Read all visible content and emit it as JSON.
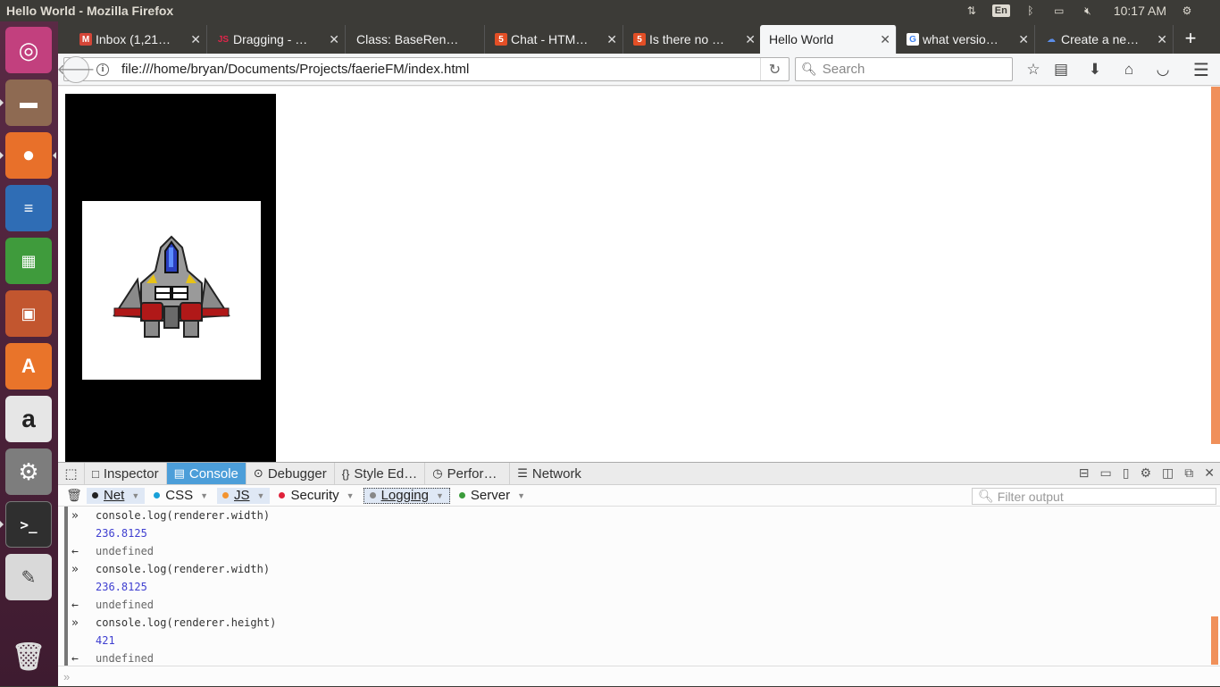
{
  "topbar": {
    "title": "Hello World - Mozilla Firefox",
    "language": "En",
    "time": "10:17 AM"
  },
  "tabs": [
    {
      "label": "Inbox (1,21…",
      "favicon": "gmail-icon",
      "color": "#d44638",
      "glyph": "M"
    },
    {
      "label": "Dragging - …",
      "favicon": "js-icon",
      "color": "#e0254a",
      "glyph": "JS"
    },
    {
      "label": "Class: BaseRen…",
      "favicon": "",
      "color": "",
      "glyph": ""
    },
    {
      "label": "Chat - HTM…",
      "favicon": "html5-icon",
      "color": "#e34f26",
      "glyph": "5"
    },
    {
      "label": "Is there no …",
      "favicon": "html5-icon",
      "color": "#e34f26",
      "glyph": "5"
    },
    {
      "label": "Hello World",
      "favicon": "",
      "color": "",
      "glyph": ""
    },
    {
      "label": "what versio…",
      "favicon": "google-icon",
      "color": "#4285f4",
      "glyph": "G"
    },
    {
      "label": "Create a ne…",
      "favicon": "cloud-icon",
      "color": "#3b6fd8",
      "glyph": "☁"
    }
  ],
  "navbar": {
    "url": "file:///home/bryan/Documents/Projects/faerieFM/index.html",
    "search_placeholder": "Search"
  },
  "devtools": {
    "tabs": [
      {
        "label": "Inspector",
        "icon": "□"
      },
      {
        "label": "Console",
        "icon": "▤"
      },
      {
        "label": "Debugger",
        "icon": "⊙"
      },
      {
        "label": "Style Ed…",
        "icon": "{}"
      },
      {
        "label": "Perfor…",
        "icon": "◷"
      },
      {
        "label": "Network",
        "icon": "☰"
      }
    ],
    "filters": [
      {
        "label": "Net",
        "color": "#222222"
      },
      {
        "label": "CSS",
        "color": "#18a0d8"
      },
      {
        "label": "JS",
        "color": "#f39430"
      },
      {
        "label": "Security",
        "color": "#e0223a"
      },
      {
        "label": "Logging",
        "color": "#888888"
      },
      {
        "label": "Server",
        "color": "#3b9c3b"
      }
    ],
    "filter_placeholder": "Filter output",
    "log": [
      {
        "kind": "input",
        "text": "console.log(renderer.width)"
      },
      {
        "kind": "number",
        "text": "236.8125"
      },
      {
        "kind": "return",
        "text": "undefined"
      },
      {
        "kind": "input",
        "text": "console.log(renderer.width)"
      },
      {
        "kind": "number",
        "text": "236.8125"
      },
      {
        "kind": "return",
        "text": "undefined"
      },
      {
        "kind": "input",
        "text": "console.log(renderer.height)"
      },
      {
        "kind": "number",
        "text": "421"
      },
      {
        "kind": "return",
        "text": "undefined"
      }
    ]
  },
  "launcher": [
    {
      "name": "ubuntu-dash-icon",
      "color": "#c2407e"
    },
    {
      "name": "files-icon",
      "color": "#8e6a52"
    },
    {
      "name": "firefox-icon",
      "color": "#e8702a"
    },
    {
      "name": "writer-icon",
      "color": "#2f6db5"
    },
    {
      "name": "calc-icon",
      "color": "#3f9b3c"
    },
    {
      "name": "impress-icon",
      "color": "#c2562f"
    },
    {
      "name": "software-center-icon",
      "color": "#e9742a"
    },
    {
      "name": "amazon-icon",
      "color": "#e6e6e6"
    },
    {
      "name": "settings-icon",
      "color": "#7d7d7d"
    },
    {
      "name": "terminal-icon",
      "color": "#2f2f2f"
    },
    {
      "name": "text-editor-icon",
      "color": "#d9d9d9"
    },
    {
      "name": "trash-icon",
      "color": "#aaaaaa"
    }
  ]
}
